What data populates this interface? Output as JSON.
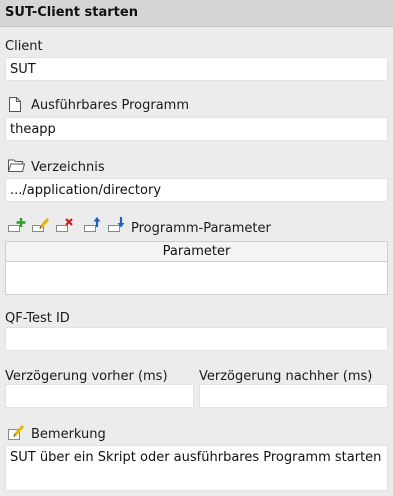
{
  "header": {
    "title": "SUT-Client starten"
  },
  "client": {
    "label": "Client",
    "value": "SUT"
  },
  "program": {
    "label": "Ausführbares Programm",
    "value": "theapp",
    "icon": "file-icon"
  },
  "directory": {
    "label": "Verzeichnis",
    "value": ".../application/directory",
    "icon": "folder-icon"
  },
  "params": {
    "label": "Programm-Parameter",
    "column": "Parameter",
    "toolbar": [
      "add-icon",
      "edit-icon",
      "delete-icon",
      "move-up-icon",
      "move-down-icon"
    ],
    "rows": []
  },
  "qftest_id": {
    "label": "QF-Test ID",
    "value": ""
  },
  "delay_before": {
    "label": "Verzögerung vorher (ms)",
    "value": ""
  },
  "delay_after": {
    "label": "Verzögerung nachher (ms)",
    "value": ""
  },
  "comment": {
    "label": "Bemerkung",
    "value": "SUT über ein Skript oder ausführbares Programm starten",
    "icon": "pencil-note-icon"
  },
  "colors": {
    "add": "#2aa12a",
    "edit": "#e8b400",
    "delete": "#cc1f1f",
    "arrows": "#1f5fc8"
  }
}
